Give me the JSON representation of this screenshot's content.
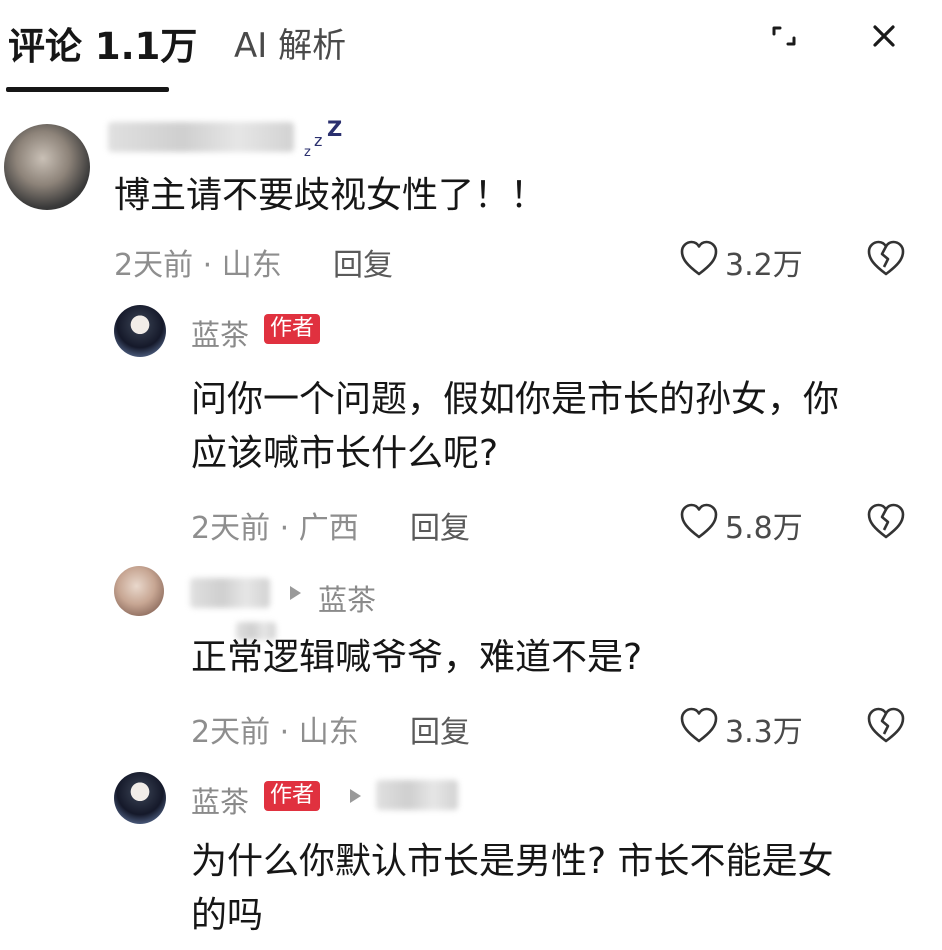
{
  "header": {
    "tab_comments": "评论 1.1万",
    "tab_ai": "AI 解析",
    "expand_icon": "expand-icon",
    "close_icon": "close-icon"
  },
  "comments": [
    {
      "text": "博主请不要歧视女性了！！",
      "time": "2天前 · 山东",
      "reply_label": "回复",
      "likes": "3.2万"
    },
    {
      "username": "蓝茶",
      "badge": "作者",
      "text_lines": [
        "问你一个问题，假如你是市长的孙女，你",
        "应该喊市长什么呢?"
      ],
      "time": "2天前 · 广西",
      "reply_label": "回复",
      "likes": "5.8万"
    },
    {
      "reply_to": "蓝茶",
      "text": "正常逻辑喊爷爷，难道不是?",
      "time": "2天前 · 山东",
      "reply_label": "回复",
      "likes": "3.3万"
    },
    {
      "username": "蓝茶",
      "badge": "作者",
      "text_lines": [
        "为什么你默认市长是男性? 市长不能是女",
        "的吗"
      ]
    }
  ],
  "colors": {
    "badge": "#e0313f",
    "text": "#161616",
    "meta": "#8e8e8e"
  }
}
